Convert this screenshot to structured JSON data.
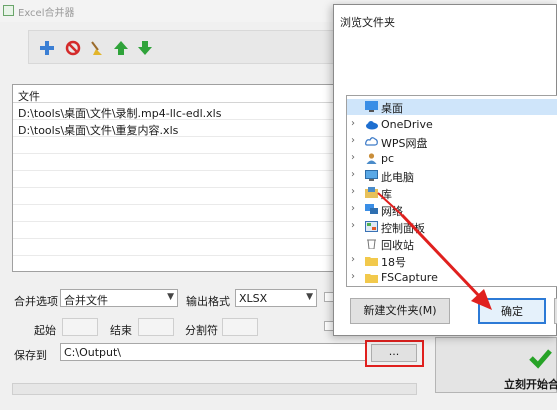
{
  "main_window": {
    "title": "Excel合并器",
    "toolbar": {
      "icons": [
        "add-icon",
        "delete-icon",
        "clear-icon",
        "move-up-icon",
        "move-down-icon"
      ]
    },
    "file_list": {
      "header": "文件",
      "files": [
        "D:\\tools\\桌面\\文件\\录制.mp4-llc-edl.xls",
        "D:\\tools\\桌面\\文件\\重复内容.xls"
      ]
    },
    "merge_option_label": "合并选项",
    "merge_option_value": "合并文件",
    "output_format_label": "输出格式",
    "output_format_value": "XLSX",
    "start_label": "起始",
    "end_label": "结束",
    "separator_label": "分割符",
    "save_to_label": "保存到",
    "save_path": "C:\\Output\\",
    "browse_label": "...",
    "start_button_label": "立刻开始合",
    "colors": {
      "highlight_red": "#e0201e",
      "check_green": "#27a327",
      "selected_blue": "#cfe5fa"
    }
  },
  "dialog": {
    "title": "浏览文件夹",
    "tree": [
      {
        "label": "桌面",
        "icon": "desktop-icon",
        "selected": true,
        "expander": ""
      },
      {
        "label": "OneDrive",
        "icon": "onedrive-icon",
        "expander": "›"
      },
      {
        "label": "WPS网盘",
        "icon": "wps-cloud-icon",
        "expander": "›"
      },
      {
        "label": "pc",
        "icon": "user-icon",
        "expander": "›"
      },
      {
        "label": "此电脑",
        "icon": "computer-icon",
        "expander": "›"
      },
      {
        "label": "库",
        "icon": "library-icon",
        "expander": "›"
      },
      {
        "label": "网络",
        "icon": "network-icon",
        "expander": "›"
      },
      {
        "label": "控制面板",
        "icon": "control-panel-icon",
        "expander": "›"
      },
      {
        "label": "回收站",
        "icon": "recycle-bin-icon",
        "expander": ""
      },
      {
        "label": "18号",
        "icon": "folder-icon",
        "expander": "›"
      },
      {
        "label": "FSCapture",
        "icon": "folder-icon",
        "expander": "›"
      }
    ],
    "new_folder_button": "新建文件夹(M)",
    "ok_button": "确定"
  }
}
